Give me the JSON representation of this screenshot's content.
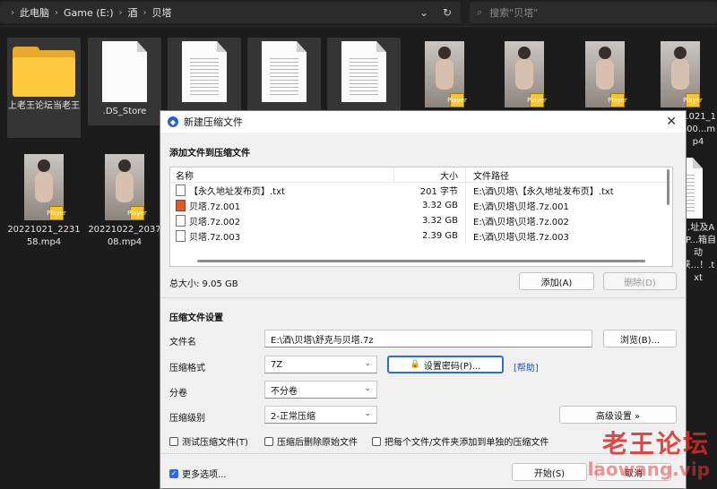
{
  "explorer": {
    "breadcrumb": [
      "此电脑",
      "Game (E:)",
      "酒",
      "贝塔"
    ],
    "search_placeholder": "搜索\"贝塔\"",
    "items": [
      {
        "name": "上老王论坛当老王",
        "kind": "folder"
      },
      {
        "name": ".DS_Store",
        "kind": "doc"
      },
      {
        "name": "",
        "kind": "doc"
      },
      {
        "name": "",
        "kind": "doc"
      },
      {
        "name": "",
        "kind": "doc"
      },
      {
        "name": "",
        "kind": "video"
      },
      {
        "name": "",
        "kind": "video"
      },
      {
        "name": "",
        "kind": "video"
      },
      {
        "name": "...021_1900...mp4",
        "kind": "video"
      },
      {
        "name": "20221021_223158.mp4",
        "kind": "video"
      },
      {
        "name": "20221022_203708.mp4",
        "kind": "video"
      },
      {
        "name": "...址及APP...箱自动获...！.txt",
        "kind": "doc"
      }
    ],
    "badge_text": "Player"
  },
  "dialog": {
    "title": "新建压缩文件",
    "add_section": "添加文件到压缩文件",
    "columns": {
      "name": "名称",
      "size": "大小",
      "path": "文件路径"
    },
    "files": [
      {
        "name": "【永久地址发布页】.txt",
        "size": "201 字节",
        "path": "E:\\酒\\贝塔\\【永久地址发布页】.txt",
        "icon": "txt"
      },
      {
        "name": "贝塔.7z.001",
        "size": "3.32 GB",
        "path": "E:\\酒\\贝塔\\贝塔.7z.001",
        "icon": "zip"
      },
      {
        "name": "贝塔.7z.002",
        "size": "3.32 GB",
        "path": "E:\\酒\\贝塔\\贝塔.7z.002",
        "icon": "txt"
      },
      {
        "name": "贝塔.7z.003",
        "size": "2.39 GB",
        "path": "E:\\酒\\贝塔\\贝塔.7z.003",
        "icon": "txt"
      }
    ],
    "total": "总大小: 9.05 GB",
    "add_btn": "添加(A)",
    "del_btn": "删除(D)",
    "settings_section": "压缩文件设置",
    "filename_label": "文件名",
    "filename_value": "E:\\酒\\贝塔\\舒克与贝塔.7z",
    "browse_btn": "浏览(B)...",
    "format_label": "压缩格式",
    "format_value": "7Z",
    "password_btn": "设置密码(P)...",
    "help_link": "[帮助]",
    "split_label": "分卷",
    "split_value": "不分卷",
    "level_label": "压缩级别",
    "level_value": "2-正常压缩",
    "advanced_btn": "高级设置 »",
    "check_test": "测试压缩文件(T)",
    "check_delete": "压缩后删除原始文件",
    "check_each": "把每个文件/文件夹添加到单独的压缩文件",
    "more_options": "更多选项...",
    "start_btn": "开始(S)",
    "cancel_btn": "取消"
  },
  "watermark": {
    "line1": "老王论坛",
    "line2": "laowang.vip"
  }
}
